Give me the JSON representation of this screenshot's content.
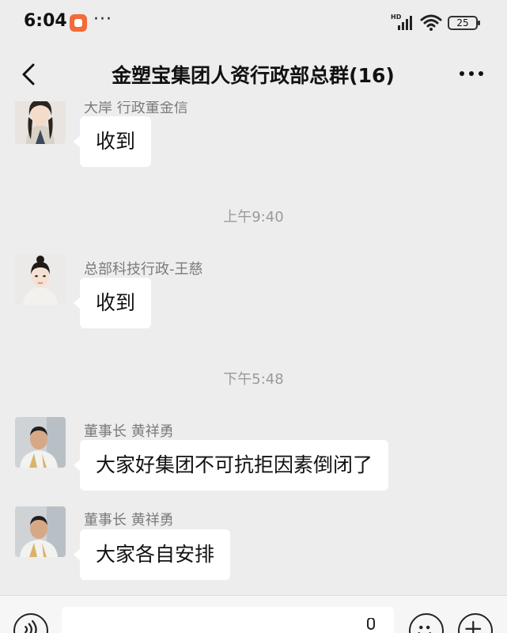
{
  "status_bar": {
    "time": "6:04",
    "dots": "···",
    "signal_label": "HD",
    "battery": "25"
  },
  "header": {
    "title": "金塑宝集团人资行政部总群(16)"
  },
  "messages": [
    {
      "sender": "大岸 行政董金信",
      "text": "收到"
    },
    {
      "sender": "总部科技行政-王慈",
      "text": "收到"
    },
    {
      "sender": "董事长 黄祥勇",
      "text": "大家好集团不可抗拒因素倒闭了"
    },
    {
      "sender": "董事长 黄祥勇",
      "text": "大家各自安排"
    }
  ],
  "timestamps": [
    "上午9:40",
    "下午5:48"
  ],
  "input": {
    "placeholder": ""
  },
  "colors": {
    "background": "#ededed",
    "bubble": "#ffffff",
    "app_badge": "#f26b3a"
  }
}
